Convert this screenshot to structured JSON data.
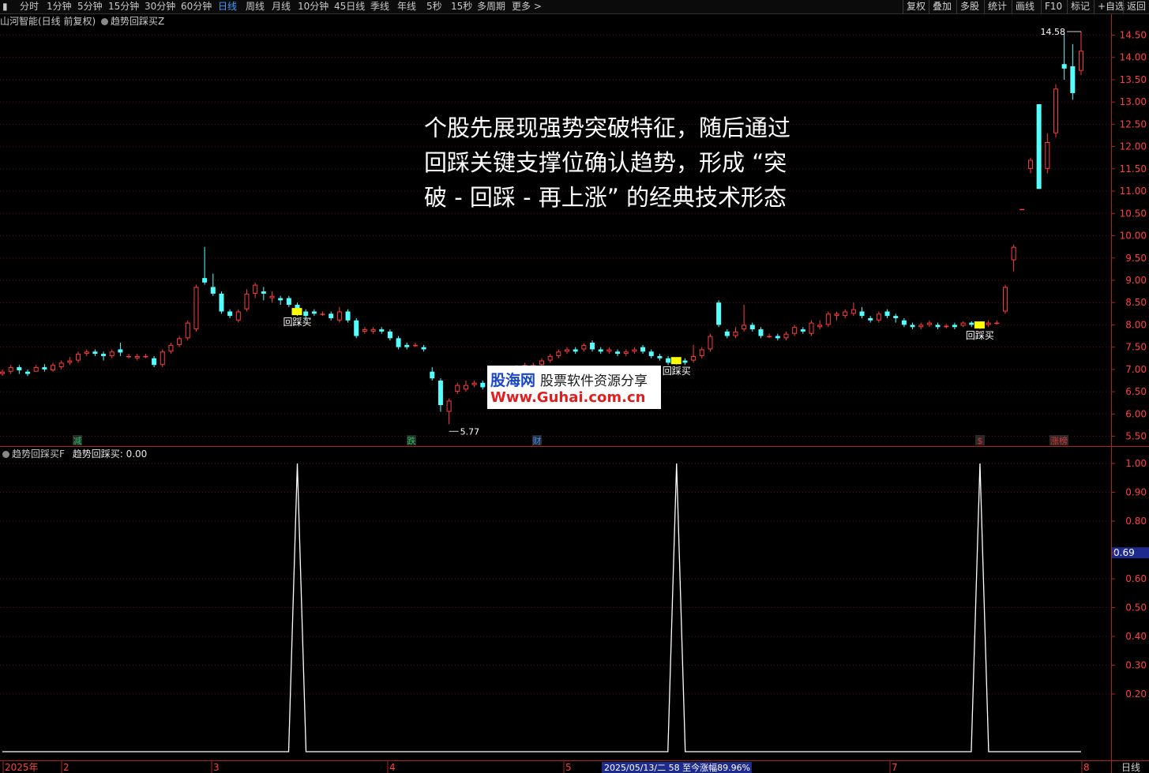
{
  "toolbar": {
    "periods": [
      "分时",
      "1分钟",
      "5分钟",
      "15分钟",
      "30分钟",
      "60分钟",
      "日线",
      "周线",
      "月线",
      "10分钟",
      "45日线",
      "季线",
      "年线",
      "5秒",
      "15秒",
      "多周期",
      "更多 >"
    ],
    "active_period": "日线",
    "right_buttons": [
      "复权",
      "叠加",
      "多股",
      "统计",
      "画线",
      "F10",
      "标记",
      "+自选",
      "返回"
    ]
  },
  "main_panel": {
    "stock_title": "山河智能(日线 前复权)",
    "indicator_label": "趋势回踩买Z",
    "annotation_lines": [
      "个股先展现强势突破特征，随后通过",
      "回踩关键支撑位确认趋势，形成 “突",
      "破 - 回踩 - 再上涨” 的经典技术形态"
    ],
    "buy_signal_label": "回踩买",
    "high_label": "14.58",
    "low_label": "5.77",
    "price_axis": [
      "14.50",
      "14.00",
      "13.50",
      "13.00",
      "12.50",
      "12.00",
      "11.50",
      "11.00",
      "10.50",
      "10.00",
      "9.50",
      "9.00",
      "8.50",
      "8.00",
      "7.50",
      "7.00",
      "6.50",
      "6.00",
      "5.50"
    ],
    "event_markers": [
      {
        "text": "减",
        "color": "#22c05a"
      },
      {
        "text": "跌",
        "color": "#22c05a"
      },
      {
        "text": "财",
        "color": "#3a8cff"
      },
      {
        "text": "$",
        "color": "#e03030"
      },
      {
        "text": "涨榜",
        "color": "#e03030"
      }
    ]
  },
  "sub_panel": {
    "indicator_name": "趋势回踩买F",
    "value_label": "趋势回踩买: 0.00",
    "axis": [
      "1.00",
      "0.90",
      "0.80",
      "0.69",
      "0.60",
      "0.50",
      "0.40",
      "0.30",
      "0.20"
    ],
    "highlight_value": "0.69"
  },
  "bottom_axis": {
    "labels": [
      "2025年",
      "2",
      "3",
      "4",
      "5",
      "7",
      "8"
    ],
    "status_text": "2025/05/13/二 58 至今涨幅89.96%",
    "right_label": "日线"
  },
  "watermark": {
    "line1": "股海网",
    "line1_sub": "股票软件资源分享",
    "line2": "Www.Guhai.com.cn"
  },
  "chart_data": {
    "type": "candlestick",
    "price_range": [
      5.3,
      14.7
    ],
    "up_color": "#ff3c3c",
    "down_color": "#54ffff",
    "candles": [
      {
        "o": 6.9,
        "c": 6.95,
        "h": 7.0,
        "l": 6.85
      },
      {
        "o": 6.95,
        "c": 7.05,
        "h": 7.1,
        "l": 6.9
      },
      {
        "o": 7.05,
        "c": 6.98,
        "h": 7.1,
        "l": 6.9
      },
      {
        "o": 6.95,
        "c": 6.9,
        "h": 7.0,
        "l": 6.85
      },
      {
        "o": 6.95,
        "c": 7.05,
        "h": 7.1,
        "l": 6.95
      },
      {
        "o": 7.05,
        "c": 7.0,
        "h": 7.12,
        "l": 6.95
      },
      {
        "o": 6.98,
        "c": 7.1,
        "h": 7.15,
        "l": 6.95
      },
      {
        "o": 7.05,
        "c": 7.15,
        "h": 7.2,
        "l": 7.0
      },
      {
        "o": 7.15,
        "c": 7.2,
        "h": 7.28,
        "l": 7.1
      },
      {
        "o": 7.2,
        "c": 7.35,
        "h": 7.4,
        "l": 7.15
      },
      {
        "o": 7.35,
        "c": 7.4,
        "h": 7.45,
        "l": 7.3
      },
      {
        "o": 7.4,
        "c": 7.35,
        "h": 7.45,
        "l": 7.3
      },
      {
        "o": 7.35,
        "c": 7.3,
        "h": 7.4,
        "l": 7.2
      },
      {
        "o": 7.3,
        "c": 7.4,
        "h": 7.45,
        "l": 7.25
      },
      {
        "o": 7.45,
        "c": 7.38,
        "h": 7.6,
        "l": 7.3
      },
      {
        "o": 7.3,
        "c": 7.3,
        "h": 7.35,
        "l": 7.25
      },
      {
        "o": 7.25,
        "c": 7.3,
        "h": 7.35,
        "l": 7.2
      },
      {
        "o": 7.3,
        "c": 7.3,
        "h": 7.35,
        "l": 7.25
      },
      {
        "o": 7.25,
        "c": 7.1,
        "h": 7.3,
        "l": 7.05
      },
      {
        "o": 7.1,
        "c": 7.4,
        "h": 7.45,
        "l": 7.05
      },
      {
        "o": 7.4,
        "c": 7.55,
        "h": 7.6,
        "l": 7.35
      },
      {
        "o": 7.55,
        "c": 7.7,
        "h": 7.75,
        "l": 7.5
      },
      {
        "o": 7.7,
        "c": 8.05,
        "h": 8.1,
        "l": 7.65
      },
      {
        "o": 7.9,
        "c": 8.85,
        "h": 8.9,
        "l": 7.85
      },
      {
        "o": 9.05,
        "c": 8.95,
        "h": 9.75,
        "l": 8.9
      },
      {
        "o": 8.85,
        "c": 8.7,
        "h": 9.15,
        "l": 8.65
      },
      {
        "o": 8.7,
        "c": 8.3,
        "h": 8.75,
        "l": 8.25
      },
      {
        "o": 8.3,
        "c": 8.2,
        "h": 8.35,
        "l": 8.15
      },
      {
        "o": 8.1,
        "c": 8.3,
        "h": 8.35,
        "l": 8.05
      },
      {
        "o": 8.35,
        "c": 8.7,
        "h": 8.8,
        "l": 8.3
      },
      {
        "o": 8.7,
        "c": 8.9,
        "h": 8.95,
        "l": 8.6
      },
      {
        "o": 8.75,
        "c": 8.7,
        "h": 8.85,
        "l": 8.55
      },
      {
        "o": 8.6,
        "c": 8.65,
        "h": 8.75,
        "l": 8.5
      },
      {
        "o": 8.6,
        "c": 8.55,
        "h": 8.65,
        "l": 8.45
      },
      {
        "o": 8.6,
        "c": 8.45,
        "h": 8.65,
        "l": 8.4
      },
      {
        "o": 8.45,
        "c": 8.25,
        "h": 8.5,
        "l": 8.2
      },
      {
        "o": 8.3,
        "c": 8.2,
        "h": 8.35,
        "l": 8.1
      },
      {
        "o": 8.3,
        "c": 8.25,
        "h": 8.35,
        "l": 8.2
      },
      {
        "o": 8.25,
        "c": 8.25,
        "h": 8.3,
        "l": 8.2
      },
      {
        "o": 8.25,
        "c": 8.15,
        "h": 8.3,
        "l": 8.1
      },
      {
        "o": 8.1,
        "c": 8.3,
        "h": 8.4,
        "l": 8.05
      },
      {
        "o": 8.3,
        "c": 8.1,
        "h": 8.35,
        "l": 8.05
      },
      {
        "o": 8.1,
        "c": 7.75,
        "h": 8.15,
        "l": 7.7
      },
      {
        "o": 7.85,
        "c": 7.9,
        "h": 7.95,
        "l": 7.8
      },
      {
        "o": 7.85,
        "c": 7.9,
        "h": 7.95,
        "l": 7.8
      },
      {
        "o": 7.9,
        "c": 7.85,
        "h": 7.95,
        "l": 7.8
      },
      {
        "o": 7.85,
        "c": 7.7,
        "h": 7.9,
        "l": 7.65
      },
      {
        "o": 7.7,
        "c": 7.5,
        "h": 7.75,
        "l": 7.45
      },
      {
        "o": 7.55,
        "c": 7.5,
        "h": 7.6,
        "l": 7.45
      },
      {
        "o": 7.55,
        "c": 7.55,
        "h": 7.6,
        "l": 7.5
      },
      {
        "o": 7.5,
        "c": 7.45,
        "h": 7.55,
        "l": 7.4
      },
      {
        "o": 6.95,
        "c": 6.8,
        "h": 7.05,
        "l": 6.75
      },
      {
        "o": 6.75,
        "c": 6.2,
        "h": 6.8,
        "l": 6.05
      },
      {
        "o": 6.05,
        "c": 6.3,
        "h": 6.35,
        "l": 5.77
      },
      {
        "o": 6.5,
        "c": 6.65,
        "h": 6.7,
        "l": 6.45
      },
      {
        "o": 6.55,
        "c": 6.65,
        "h": 6.75,
        "l": 6.5
      },
      {
        "o": 6.65,
        "c": 6.7,
        "h": 6.75,
        "l": 6.6
      },
      {
        "o": 6.7,
        "c": 6.6,
        "h": 6.75,
        "l": 6.55
      },
      {
        "o": 6.6,
        "c": 6.5,
        "h": 6.65,
        "l": 6.45
      },
      {
        "o": 6.55,
        "c": 6.55,
        "h": 6.6,
        "l": 6.5
      },
      {
        "o": 6.55,
        "c": 6.5,
        "h": 6.6,
        "l": 6.45
      },
      {
        "o": 6.95,
        "c": 7.05,
        "h": 7.1,
        "l": 6.9
      },
      {
        "o": 7.05,
        "c": 7.1,
        "h": 7.15,
        "l": 7.0
      },
      {
        "o": 7.05,
        "c": 7.1,
        "h": 7.15,
        "l": 7.0
      },
      {
        "o": 7.1,
        "c": 7.2,
        "h": 7.25,
        "l": 7.05
      },
      {
        "o": 7.2,
        "c": 7.3,
        "h": 7.35,
        "l": 7.15
      },
      {
        "o": 7.3,
        "c": 7.4,
        "h": 7.45,
        "l": 7.25
      },
      {
        "o": 7.4,
        "c": 7.45,
        "h": 7.5,
        "l": 7.35
      },
      {
        "o": 7.45,
        "c": 7.4,
        "h": 7.5,
        "l": 7.35
      },
      {
        "o": 7.45,
        "c": 7.55,
        "h": 7.58,
        "l": 7.4
      },
      {
        "o": 7.6,
        "c": 7.45,
        "h": 7.65,
        "l": 7.4
      },
      {
        "o": 7.45,
        "c": 7.4,
        "h": 7.5,
        "l": 7.35
      },
      {
        "o": 7.4,
        "c": 7.45,
        "h": 7.5,
        "l": 7.35
      },
      {
        "o": 7.4,
        "c": 7.35,
        "h": 7.45,
        "l": 7.3
      },
      {
        "o": 7.35,
        "c": 7.4,
        "h": 7.45,
        "l": 7.3
      },
      {
        "o": 7.4,
        "c": 7.45,
        "h": 7.5,
        "l": 7.35
      },
      {
        "o": 7.5,
        "c": 7.4,
        "h": 7.55,
        "l": 7.35
      },
      {
        "o": 7.4,
        "c": 7.3,
        "h": 7.45,
        "l": 7.25
      },
      {
        "o": 7.3,
        "c": 7.25,
        "h": 7.35,
        "l": 7.2
      },
      {
        "o": 7.25,
        "c": 7.15,
        "h": 7.3,
        "l": 7.1
      },
      {
        "o": 7.15,
        "c": 7.2,
        "h": 7.25,
        "l": 7.1
      },
      {
        "o": 7.2,
        "c": 7.15,
        "h": 7.25,
        "l": 7.1
      },
      {
        "o": 7.2,
        "c": 7.3,
        "h": 7.55,
        "l": 7.15
      },
      {
        "o": 7.3,
        "c": 7.45,
        "h": 7.5,
        "l": 7.25
      },
      {
        "o": 7.45,
        "c": 7.75,
        "h": 7.8,
        "l": 7.4
      },
      {
        "o": 8.5,
        "c": 8.0,
        "h": 8.55,
        "l": 7.95
      },
      {
        "o": 7.85,
        "c": 7.75,
        "h": 7.9,
        "l": 7.7
      },
      {
        "o": 7.75,
        "c": 7.85,
        "h": 7.95,
        "l": 7.7
      },
      {
        "o": 7.9,
        "c": 8.0,
        "h": 8.45,
        "l": 7.85
      },
      {
        "o": 8.0,
        "c": 7.9,
        "h": 8.05,
        "l": 7.85
      },
      {
        "o": 7.9,
        "c": 7.75,
        "h": 7.95,
        "l": 7.7
      },
      {
        "o": 7.75,
        "c": 7.75,
        "h": 7.8,
        "l": 7.7
      },
      {
        "o": 7.75,
        "c": 7.7,
        "h": 7.8,
        "l": 7.65
      },
      {
        "o": 7.7,
        "c": 7.8,
        "h": 7.85,
        "l": 7.65
      },
      {
        "o": 7.8,
        "c": 7.95,
        "h": 8.0,
        "l": 7.75
      },
      {
        "o": 7.9,
        "c": 7.85,
        "h": 7.95,
        "l": 7.8
      },
      {
        "o": 7.8,
        "c": 8.05,
        "h": 8.1,
        "l": 7.75
      },
      {
        "o": 7.95,
        "c": 8.0,
        "h": 8.1,
        "l": 7.9
      },
      {
        "o": 8.0,
        "c": 8.25,
        "h": 8.3,
        "l": 7.95
      },
      {
        "o": 8.2,
        "c": 8.25,
        "h": 8.3,
        "l": 8.1
      },
      {
        "o": 8.2,
        "c": 8.3,
        "h": 8.35,
        "l": 8.15
      },
      {
        "o": 8.25,
        "c": 8.35,
        "h": 8.5,
        "l": 8.2
      },
      {
        "o": 8.3,
        "c": 8.2,
        "h": 8.4,
        "l": 8.15
      },
      {
        "o": 8.15,
        "c": 8.1,
        "h": 8.2,
        "l": 8.05
      },
      {
        "o": 8.1,
        "c": 8.25,
        "h": 8.3,
        "l": 8.05
      },
      {
        "o": 8.3,
        "c": 8.2,
        "h": 8.35,
        "l": 8.15
      },
      {
        "o": 8.2,
        "c": 8.15,
        "h": 8.25,
        "l": 8.05
      },
      {
        "o": 8.1,
        "c": 8.0,
        "h": 8.15,
        "l": 7.95
      },
      {
        "o": 8.0,
        "c": 7.95,
        "h": 8.05,
        "l": 7.9
      },
      {
        "o": 7.95,
        "c": 8.0,
        "h": 8.05,
        "l": 7.9
      },
      {
        "o": 8.0,
        "c": 8.05,
        "h": 8.1,
        "l": 7.95
      },
      {
        "o": 8.0,
        "c": 7.95,
        "h": 8.05,
        "l": 7.9
      },
      {
        "o": 7.95,
        "c": 7.98,
        "h": 8.02,
        "l": 7.92
      },
      {
        "o": 8.0,
        "c": 7.95,
        "h": 8.05,
        "l": 7.9
      },
      {
        "o": 7.98,
        "c": 8.05,
        "h": 8.08,
        "l": 7.95
      },
      {
        "o": 8.05,
        "c": 8.0,
        "h": 8.08,
        "l": 7.95
      },
      {
        "o": 7.95,
        "c": 8.0,
        "h": 8.05,
        "l": 7.9
      },
      {
        "o": 8.0,
        "c": 8.05,
        "h": 8.1,
        "l": 7.95
      },
      {
        "o": 8.05,
        "c": 8.05,
        "h": 8.1,
        "l": 8.0
      },
      {
        "o": 8.3,
        "c": 8.85,
        "h": 8.9,
        "l": 8.25
      },
      {
        "o": 9.45,
        "c": 9.75,
        "h": 9.8,
        "l": 9.2
      },
      {
        "o": 10.6,
        "c": 10.6,
        "h": 10.6,
        "l": 10.6
      },
      {
        "o": 11.5,
        "c": 11.7,
        "h": 11.75,
        "l": 11.4
      },
      {
        "o": 12.95,
        "c": 11.05,
        "h": 12.95,
        "l": 11.05
      },
      {
        "o": 11.5,
        "c": 12.1,
        "h": 12.3,
        "l": 11.4
      },
      {
        "o": 12.3,
        "c": 13.3,
        "h": 13.4,
        "l": 12.2
      },
      {
        "o": 13.85,
        "c": 13.75,
        "h": 14.55,
        "l": 13.5
      },
      {
        "o": 13.8,
        "c": 13.2,
        "h": 14.3,
        "l": 13.05
      },
      {
        "o": 13.7,
        "c": 14.15,
        "h": 14.58,
        "l": 13.6
      }
    ],
    "buy_signals_candle_index": [
      35,
      80,
      116
    ],
    "sub_indicator_pulses_candle_index": [
      35,
      80,
      116
    ],
    "sub_range": [
      0,
      1.08
    ]
  }
}
